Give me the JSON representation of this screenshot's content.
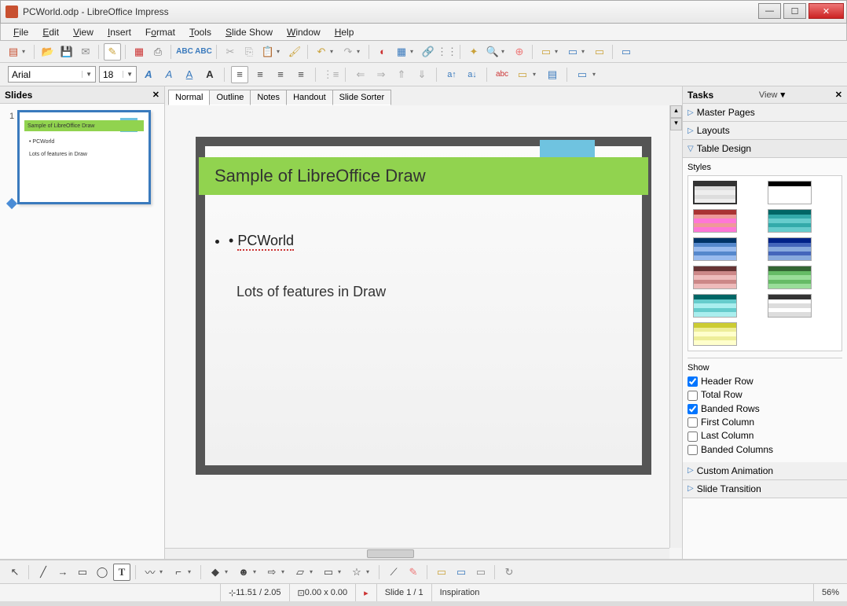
{
  "window": {
    "title": "PCWorld.odp - LibreOffice Impress"
  },
  "menus": [
    "File",
    "Edit",
    "View",
    "Insert",
    "Format",
    "Tools",
    "Slide Show",
    "Window",
    "Help"
  ],
  "font": {
    "name": "Arial",
    "size": "18"
  },
  "viewTabs": [
    "Normal",
    "Outline",
    "Notes",
    "Handout",
    "Slide Sorter"
  ],
  "activeViewTab": "Normal",
  "slidesPanel": {
    "title": "Slides",
    "slideNumber": "1"
  },
  "slide": {
    "title": "Sample of LibreOffice Draw",
    "bullet1": "PCWorld",
    "line2": "Lots of features in Draw"
  },
  "tasks": {
    "title": "Tasks",
    "viewLabel": "View",
    "sections": [
      "Master Pages",
      "Layouts",
      "Table Design",
      "Custom Animation",
      "Slide Transition"
    ],
    "expanded": "Table Design",
    "stylesLabel": "Styles",
    "showLabel": "Show",
    "show": {
      "headerRow": {
        "label": "Header Row",
        "checked": true
      },
      "totalRow": {
        "label": "Total Row",
        "checked": false
      },
      "bandedRows": {
        "label": "Banded Rows",
        "checked": true
      },
      "firstColumn": {
        "label": "First Column",
        "checked": false
      },
      "lastColumn": {
        "label": "Last Column",
        "checked": false
      },
      "bandedColumns": {
        "label": "Banded Columns",
        "checked": false
      }
    }
  },
  "status": {
    "coords": "11.51 / 2.05",
    "size": "0.00 x 0.00",
    "slide": "Slide 1 / 1",
    "theme": "Inspiration",
    "zoom": "56%"
  }
}
